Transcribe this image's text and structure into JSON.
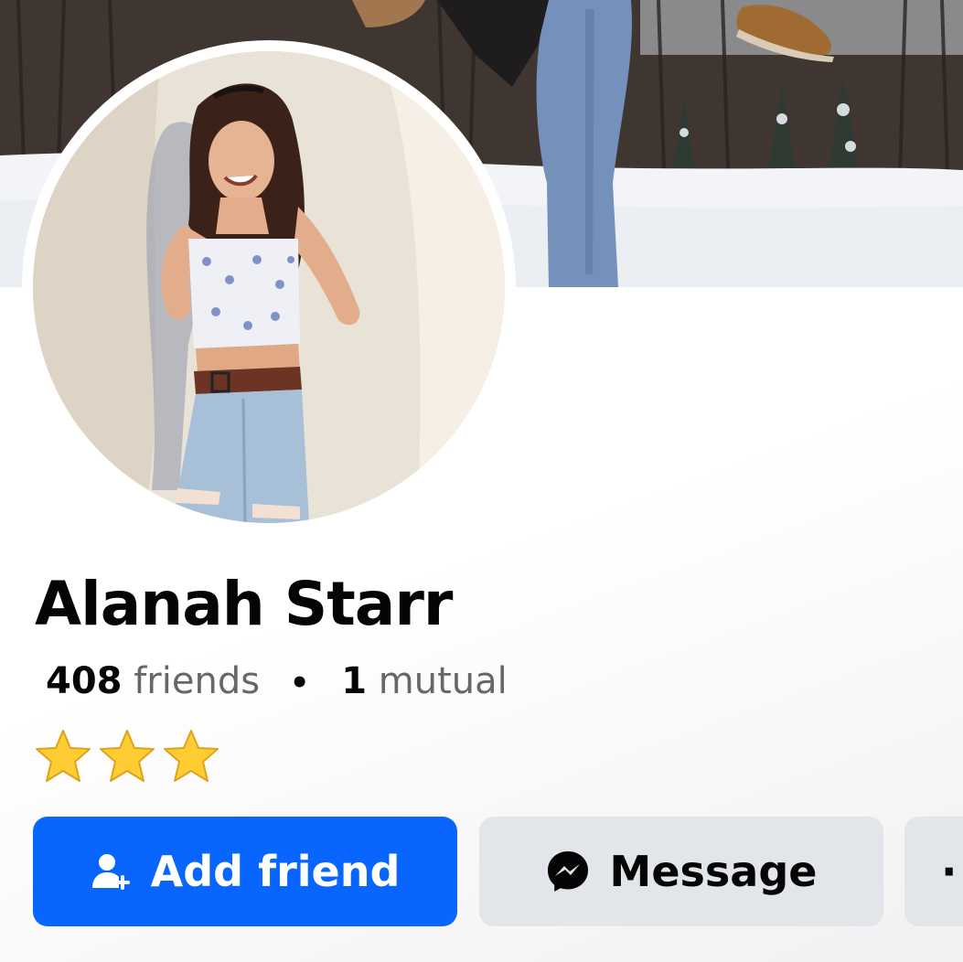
{
  "profile": {
    "name": "Alanah Starr",
    "friends_count": "408",
    "friends_label": "friends",
    "separator": "•",
    "mutual_count": "1",
    "mutual_label": "mutual",
    "stars": [
      "⭐",
      "⭐",
      "⭐"
    ]
  },
  "actions": {
    "add_friend_label": "Add friend",
    "message_label": "Message",
    "more_label": "···"
  },
  "icons": {
    "add_friend": "person-add-icon",
    "message": "messenger-icon",
    "more": "more-dots-icon",
    "star": "star-icon"
  },
  "colors": {
    "primary_blue": "#0866ff",
    "secondary_button": "#e2e5e9",
    "text_primary": "#050505",
    "text_secondary": "#65676b",
    "star_fill": "#ffcc33"
  }
}
